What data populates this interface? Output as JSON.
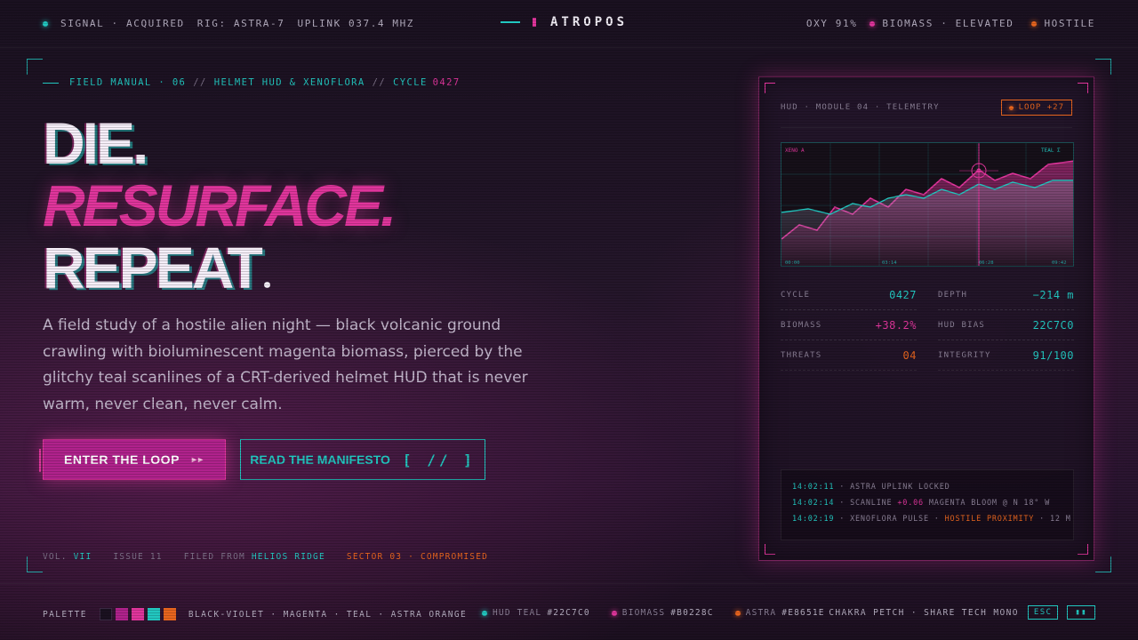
{
  "topbar": {
    "signal": "SIGNAL · ACQUIRED",
    "rig": "RIG: ASTRA-7",
    "uplink": "UPLINK 037.4 MHZ",
    "brand": "ATROPOS",
    "oxy": "OXY 91%",
    "biomass": "BIOMASS · ELEVATED",
    "hostile": "HOSTILE"
  },
  "manual": {
    "label": "FIELD MANUAL · 06",
    "sep1": "//",
    "topic": "HELMET HUD & XENOFLORA",
    "sep2": "//",
    "cycle_label": "CYCLE",
    "cycle_value": "0427"
  },
  "hero": {
    "line1": "DIE.",
    "line2": "RESURFACE.",
    "line3": "REPEAT",
    "description": "A field study of a hostile alien night — black volcanic ground crawling with bioluminescent magenta biomass, pierced by the glitchy teal scanlines of a CRT-derived helmet HUD that is never warm, never clean, never calm."
  },
  "buttons": {
    "primary": "ENTER THE LOOP",
    "primary_glyph": "▸▸",
    "secondary": "READ THE MANIFESTO",
    "secondary_glyph": "[ // ]"
  },
  "meta": {
    "vol_label": "VOL.",
    "vol_value": "VII",
    "issue": "ISSUE 11",
    "filed_label": "FILED FROM",
    "filed_value": "HELIOS RIDGE",
    "sector": "SECTOR 03 · COMPROMISED"
  },
  "panel": {
    "header": "HUD · MODULE 04 · TELEMETRY",
    "loop_badge": "LOOP +27",
    "chart_label_left": "XENO A",
    "chart_label_right": "TEAL Σ",
    "chart_ticks": [
      "00:00",
      "03:14",
      "06:28",
      "09:42"
    ],
    "stats": [
      {
        "key": "CYCLE",
        "value": "0427",
        "color": "#22c7c0"
      },
      {
        "key": "DEPTH",
        "value": "−214 m",
        "color": "#22c7c0"
      },
      {
        "key": "BIOMASS",
        "value": "+38.2%",
        "color": "#e0359c"
      },
      {
        "key": "HUD BIAS",
        "value": "22C7C0",
        "color": "#22c7c0"
      },
      {
        "key": "THREATS",
        "value": "04",
        "color": "#e8651e"
      },
      {
        "key": "INTEGRITY",
        "value": "91/100",
        "color": "#22c7c0"
      }
    ],
    "log": [
      {
        "time": "14:02:11",
        "pre": "· ASTRA UPLINK LOCKED",
        "hl": "",
        "post": ""
      },
      {
        "time": "14:02:14",
        "pre": "· SCANLINE",
        "hl": "+0.06",
        "post": "MAGENTA BLOOM @ N 18° W"
      },
      {
        "time": "14:02:19",
        "pre": "· XENOFLORA PULSE ·",
        "hl": "HOSTILE PROXIMITY",
        "post": "· 12 M"
      }
    ]
  },
  "bottombar": {
    "palette_label": "PALETTE",
    "palette_names": "BLACK-VIOLET · MAGENTA · TEAL · ASTRA ORANGE",
    "swatches": [
      "#1a1120",
      "#b0228c",
      "#e0359c",
      "#22c7c0",
      "#e8651e"
    ],
    "hud_teal_label": "HUD TEAL",
    "hud_teal_value": "#22C7C0",
    "biomass_label": "BIOMASS",
    "biomass_value": "#B0228C",
    "astra_label": "ASTRA",
    "astra_value": "#E8651E",
    "fonts": "CHAKRA PETCH · SHARE TECH MONO",
    "esc": "ESC",
    "pause": "▮▮"
  },
  "colors": {
    "teal": "#22c7c0",
    "magenta": "#e0359c",
    "biomass": "#b0228c",
    "orange": "#e8651e"
  }
}
